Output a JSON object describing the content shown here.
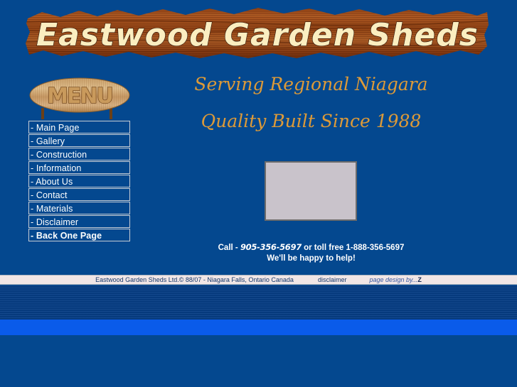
{
  "site": {
    "banner_title": "Eastwood Garden Sheds",
    "background_color": "#04488f",
    "banner_text_color": "#fbeec0",
    "accent_color": "#dd9a38"
  },
  "menu": {
    "sign_label": "MENU",
    "items": [
      {
        "label": "- Main Page"
      },
      {
        "label": "- Gallery"
      },
      {
        "label": "- Construction"
      },
      {
        "label": "- Information"
      },
      {
        "label": "- About Us"
      },
      {
        "label": "- Contact"
      },
      {
        "label": "- Materials"
      },
      {
        "label": "- Disclaimer"
      },
      {
        "label": "- Back One Page"
      }
    ]
  },
  "main": {
    "headline1": "Serving Regional Niagara",
    "headline2": "Quality Built Since 1988",
    "photo_alt": ""
  },
  "contact": {
    "call_prefix": "Call - ",
    "phone_local": "905-356-5697",
    "call_middle": " or toll free ",
    "phone_tollfree": "1-888-356-5697",
    "tagline": "We'll be happy to help!"
  },
  "footer": {
    "copyright": "Eastwood Garden Sheds Ltd.© 88/07 - Niagara Falls, Ontario Canada",
    "disclaimer_link": "disclaimer",
    "design_credit": "page design by...",
    "design_credit_initial": "Z"
  }
}
